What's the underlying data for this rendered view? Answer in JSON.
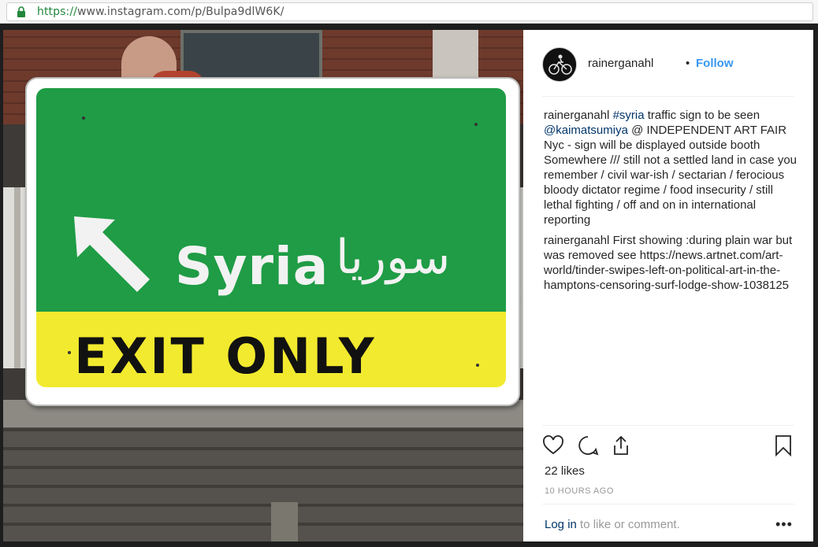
{
  "browser": {
    "url_scheme": "https://",
    "url_rest": "www.instagram.com/p/Bulpa9dlW6K/",
    "lock_icon": "lock-icon"
  },
  "photo": {
    "sign_text_en": "Syria",
    "sign_text_ar": "سوريا",
    "sign_exit": "EXIT ONLY",
    "colors": {
      "sign_green": "#1f9c45",
      "sign_yellow": "#f2ea2e"
    }
  },
  "post": {
    "username": "rainerganahl",
    "separator": "•",
    "follow_label": "Follow",
    "comments": [
      {
        "user": "rainerganahl",
        "tag1": "#syria",
        "text1": " traffic sign to be seen ",
        "tag2": "@kaimatsumiya",
        "text2": " @ INDEPENDENT ART FAIR Nyc - sign will be displayed outside booth Somewhere /// still not a settled land in case you remember / civil war-ish / sectarian / ferocious bloody dictator regime / food insecurity / still lethal fighting / off and on in international reporting"
      },
      {
        "user": "rainerganahl",
        "text": "First showing :during plain war but was removed see https://news.artnet.com/art-world/tinder-swipes-left-on-political-art-in-the-hamptons-censoring-surf-lodge-show-1038125"
      }
    ],
    "actions": {
      "like_icon": "heart-icon",
      "comment_icon": "comment-icon",
      "share_icon": "share-icon",
      "save_icon": "bookmark-icon"
    },
    "likes": "22 likes",
    "time": "10 HOURS AGO",
    "login_link": "Log in",
    "login_rest": " to like or comment.",
    "more_label": "•••",
    "accent_color": "#3897f0"
  }
}
